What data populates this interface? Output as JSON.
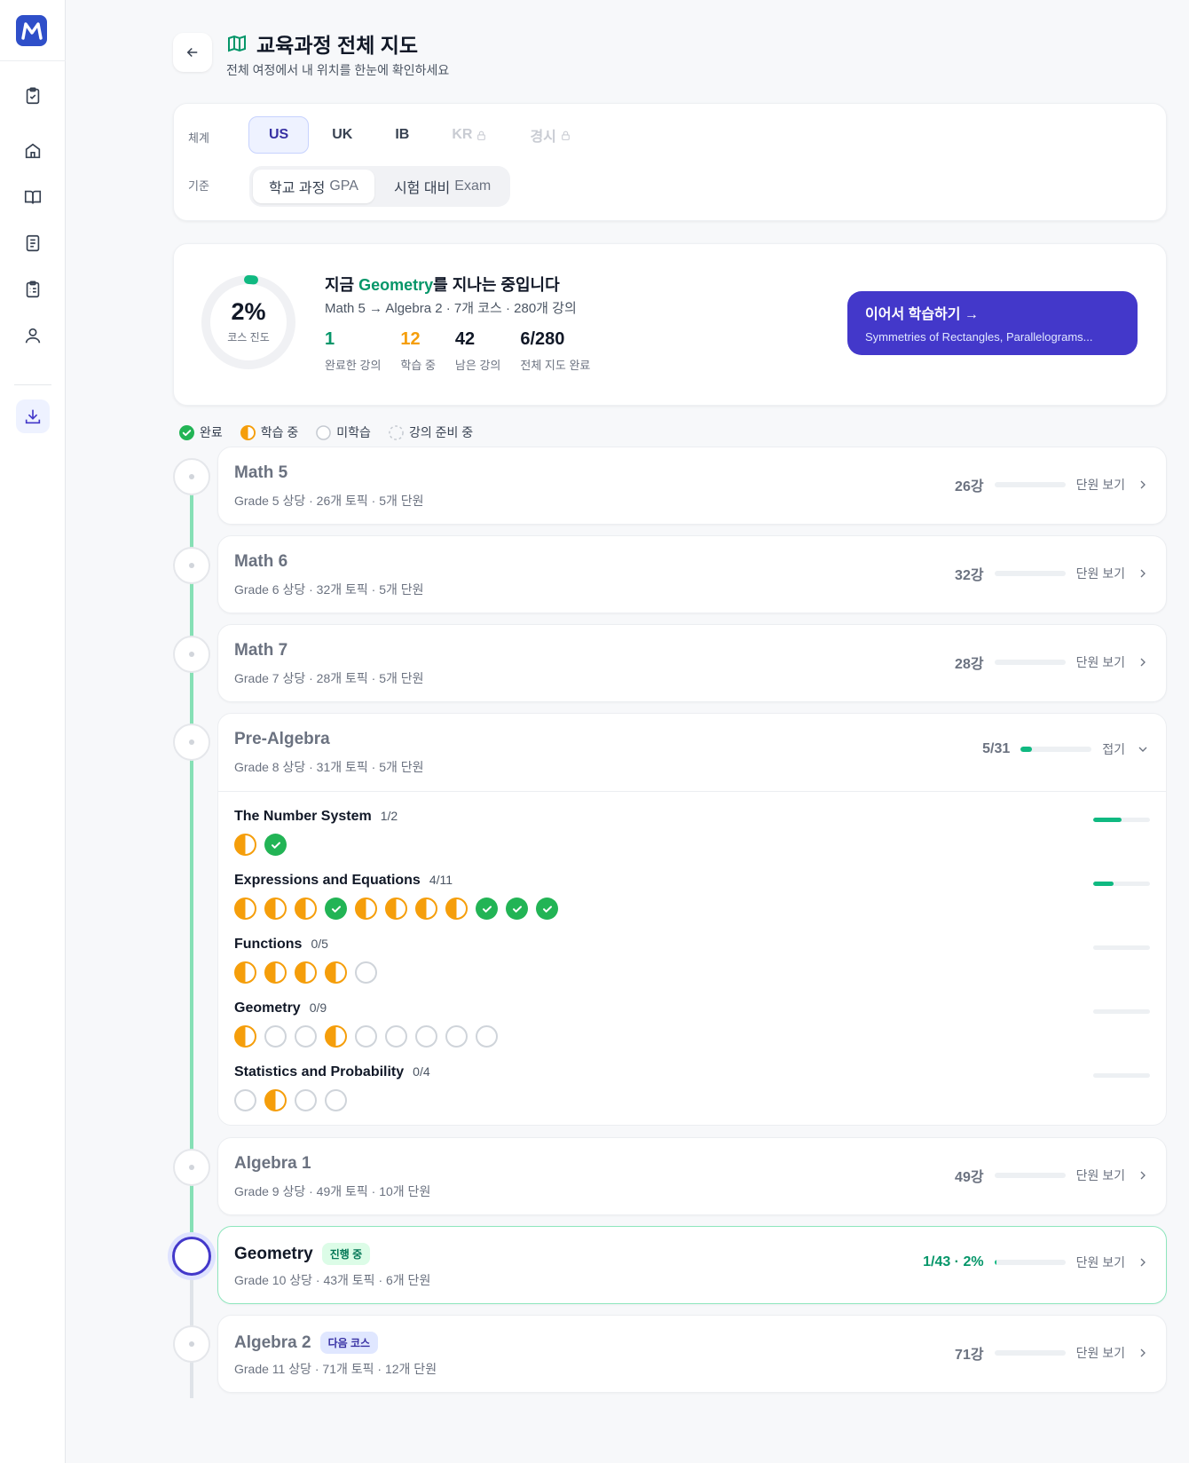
{
  "sidebar": {
    "logo": "M",
    "items": [
      {
        "icon": "clipboard-check-icon"
      },
      {
        "icon": "home-icon"
      },
      {
        "icon": "book-open-icon"
      },
      {
        "icon": "document-icon"
      },
      {
        "icon": "clipboard-list-icon"
      },
      {
        "icon": "user-icon"
      },
      {
        "icon": "download-icon"
      }
    ]
  },
  "header": {
    "title": "교육과정 전체 지도",
    "subtitle": "전체 여정에서 내 위치를 한눈에 확인하세요"
  },
  "filters": {
    "system_label": "체계",
    "systems": [
      "US",
      "UK",
      "IB",
      "KR",
      "경시"
    ],
    "selected_system": "US",
    "standard_label": "기준",
    "standards": [
      {
        "ko": "학교 과정",
        "en": "GPA"
      },
      {
        "ko": "시험 대비",
        "en": "Exam"
      }
    ]
  },
  "progress": {
    "percent": "2%",
    "percent_value": 0.02,
    "ring_label": "코스 진도",
    "title_prefix": "지금 ",
    "title_course": "Geometry",
    "title_suffix": "를 지나는 중입니다",
    "path": "Math 5 → Algebra 2 · 7개 코스 · 280개 강의",
    "stats": [
      {
        "value": "1",
        "label": "완료한 강의"
      },
      {
        "value": "12",
        "label": "학습 중"
      },
      {
        "value": "42",
        "label": "남은 강의"
      },
      {
        "value": "6/280",
        "label": "전체 지도 완료"
      }
    ],
    "continue_label": "이어서 학습하기 →",
    "continue_sub": "Symmetries of Rectangles, Parallelograms..."
  },
  "legend": [
    "완료",
    "학습 중",
    "미학습",
    "강의 준비 중"
  ],
  "courses": [
    {
      "name": "Math 5",
      "meta": "Grade 5 상당 · 26개 토픽 · 5개 단원",
      "count": "26강",
      "progress": 0,
      "link": "단원 보기"
    },
    {
      "name": "Math 6",
      "meta": "Grade 6 상당 · 32개 토픽 · 5개 단원",
      "count": "32강",
      "progress": 0,
      "link": "단원 보기"
    },
    {
      "name": "Math 7",
      "meta": "Grade 7 상당 · 28개 토픽 · 5개 단원",
      "count": "28강",
      "progress": 0,
      "link": "단원 보기"
    },
    {
      "name": "Pre-Algebra",
      "meta": "Grade 8 상당 · 31개 토픽 · 5개 단원",
      "count": "5/31",
      "progress": 0.16,
      "link": "접기"
    },
    {
      "name": "Algebra 1",
      "meta": "Grade 9 상당 · 49개 토픽 · 10개 단원",
      "count": "49강",
      "progress": 0,
      "link": "단원 보기"
    },
    {
      "name": "Geometry",
      "badge": "진행 중",
      "meta": "Grade 10 상당 · 43개 토픽 · 6개 단원",
      "count": "1/43 · 2%",
      "progress": 0.02,
      "link": "단원 보기"
    },
    {
      "name": "Algebra 2",
      "badge": "다음 코스",
      "meta": "Grade 11 상당 · 71개 토픽 · 12개 단원",
      "count": "71강",
      "progress": 0,
      "link": "단원 보기"
    }
  ],
  "units": [
    {
      "name": "The Number System",
      "count": "1/2",
      "progress": 0.5,
      "lessons": [
        "h",
        "d"
      ]
    },
    {
      "name": "Expressions and Equations",
      "count": "4/11",
      "progress": 0.36,
      "lessons": [
        "h",
        "h",
        "h",
        "d",
        "h",
        "h",
        "h",
        "h",
        "d",
        "d",
        "d"
      ]
    },
    {
      "name": "Functions",
      "count": "0/5",
      "progress": 0,
      "lessons": [
        "h",
        "h",
        "h",
        "h",
        "e"
      ]
    },
    {
      "name": "Geometry",
      "count": "0/9",
      "progress": 0,
      "lessons": [
        "h",
        "e",
        "e",
        "h",
        "e",
        "e",
        "e",
        "e",
        "e"
      ]
    },
    {
      "name": "Statistics and Probability",
      "count": "0/4",
      "progress": 0,
      "lessons": [
        "e",
        "h",
        "e",
        "e"
      ]
    }
  ],
  "colors": {
    "accent": "#4338ca",
    "done": "#22b455",
    "in_progress": "#f59e0b",
    "timeline": "#86e0b5"
  }
}
